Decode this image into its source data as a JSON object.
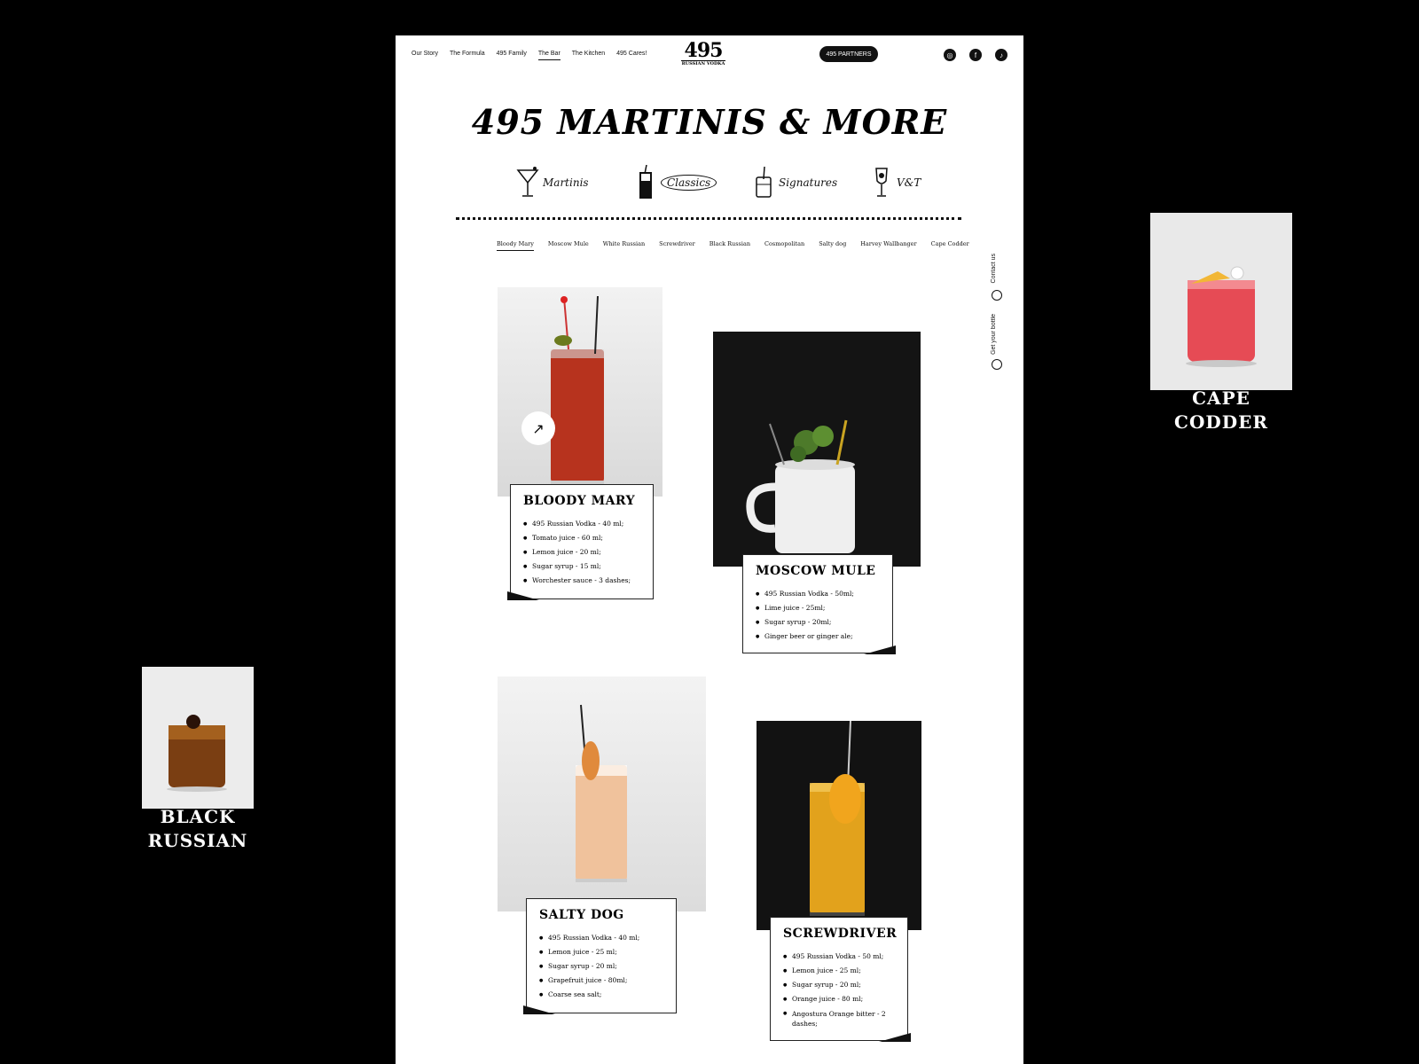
{
  "nav": {
    "items": [
      "Our Story",
      "The Formula",
      "495 Family",
      "The Bar",
      "The Kitchen",
      "495 Cares!"
    ],
    "active": "The Bar",
    "logo_number": "495",
    "logo_sub": "RUSSIAN VODKA",
    "partners_label": "495 PARTNERS",
    "social_icons": [
      "instagram-icon",
      "facebook-icon",
      "tiktok-icon"
    ]
  },
  "page_title": "495 MARTINIS & MORE",
  "categories": [
    {
      "label": "Martinis",
      "icon": "martini-glass-icon"
    },
    {
      "label": "Classics",
      "icon": "highball-glass-icon"
    },
    {
      "label": "Signatures",
      "icon": "rocks-glass-icon"
    },
    {
      "label": "V&T",
      "icon": "wine-glass-icon"
    }
  ],
  "active_category": "Classics",
  "subnav": [
    "Bloody Mary",
    "Moscow Mule",
    "White Russian",
    "Screwdriver",
    "Black Russian",
    "Cosmopolitan",
    "Salty dog",
    "Harvey Wallbanger",
    "Cape Codder"
  ],
  "active_subnav": "Bloody Mary",
  "side": {
    "contact": "Contact us",
    "bottle": "Get your bottle"
  },
  "cocktails": [
    {
      "name": "BLOODY MARY",
      "ingredients": [
        "495 Russian Vodka - 40 ml;",
        "Tomato juice - 60 ml;",
        "Lemon juice - 20 ml;",
        "Sugar syrup - 15 ml;",
        "Worchester sauce - 3 dashes;"
      ]
    },
    {
      "name": "MOSCOW MULE",
      "ingredients": [
        "495 Russian Vodka - 50ml;",
        "Lime juice - 25ml;",
        "Sugar syrup - 20ml;",
        "Ginger beer or ginger ale;"
      ]
    },
    {
      "name": "SALTY DOG",
      "ingredients": [
        "495 Russian Vodka - 40 ml;",
        "Lemon juice - 25 ml;",
        "Sugar syrup - 20 ml;",
        "Grapefruit juice - 80ml;",
        "Coarse sea salt;"
      ]
    },
    {
      "name": "SCREWDRIVER",
      "ingredients": [
        "495 Russian Vodka - 50 ml;",
        "Lemon juice - 25 ml;",
        "Sugar syrup - 20 ml;",
        "Orange juice - 80 ml;",
        "Angostura Orange bitter - 2 dashes;"
      ]
    }
  ],
  "floating": {
    "right": {
      "line1": "CAPE",
      "line2": "CODDER"
    },
    "left": {
      "line1": "BLACK",
      "line2": "RUSSIAN"
    }
  },
  "colors": {
    "background": "#000000",
    "page": "#ffffff",
    "ink": "#111111"
  }
}
